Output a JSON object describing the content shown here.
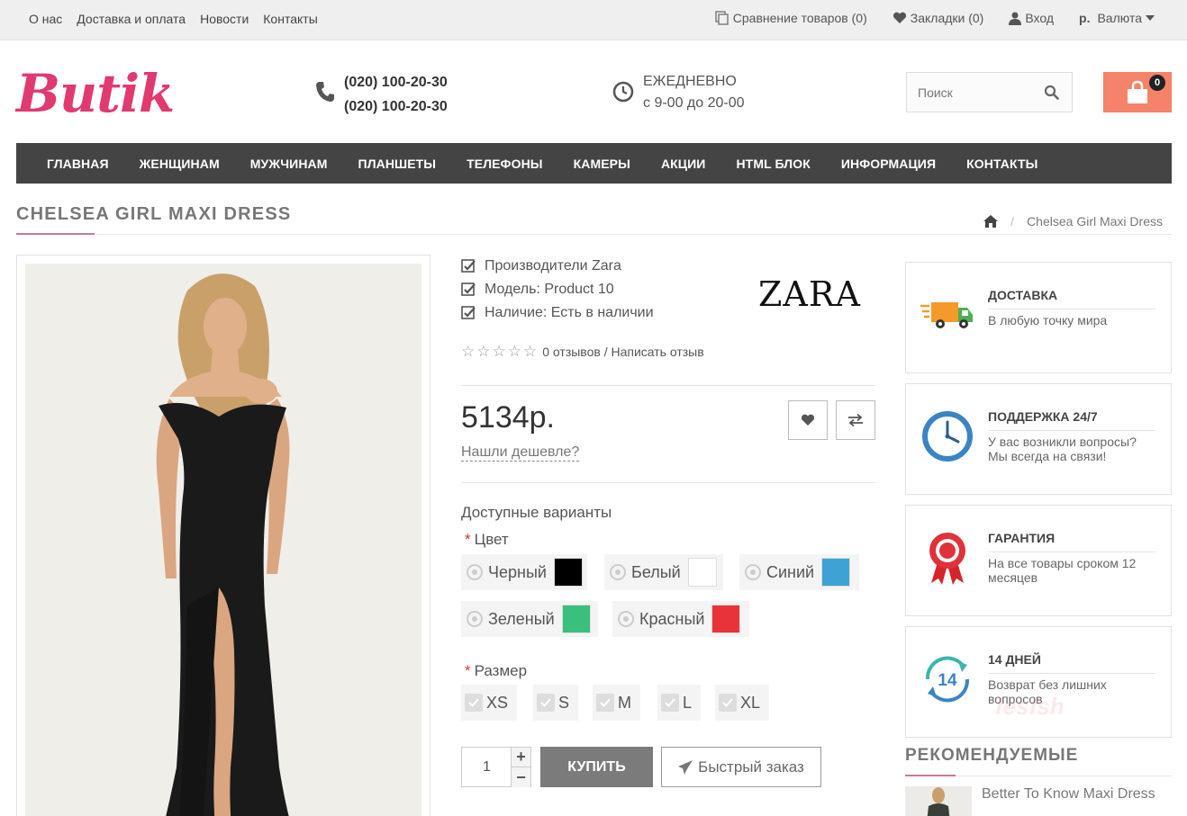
{
  "topbar": {
    "links": [
      "О нас",
      "Доставка и оплата",
      "Новости",
      "Контакты"
    ],
    "compare": "Сравнение товаров (0)",
    "bookmarks": "Закладки (0)",
    "login": "Вход",
    "currency_symbol": "р.",
    "currency_label": "Валюта"
  },
  "header": {
    "logo": "Butik",
    "phone1": "(020) 100-20-30",
    "phone2": "(020) 100-20-30",
    "hours_line1": "ЕЖЕДНЕВНО",
    "hours_line2": "с 9-00 до 20-00",
    "search_placeholder": "Поиск",
    "cart_count": "0"
  },
  "nav": [
    "ГЛАВНАЯ",
    "ЖЕНЩИНАМ",
    "МУЖЧИНАМ",
    "ПЛАНШЕТЫ",
    "ТЕЛЕФОНЫ",
    "КАМЕРЫ",
    "АКЦИИ",
    "HTML БЛОК",
    "ИНФОРМАЦИЯ",
    "КОНТАКТЫ"
  ],
  "page": {
    "title": "CHELSEA GIRL MAXI DRESS",
    "breadcrumb_current": "Chelsea Girl Maxi Dress"
  },
  "product": {
    "manufacturer": "Производители Zara",
    "model": "Модель: Product 10",
    "availability": "Наличие: Есть в наличии",
    "brand_logo": "ZARA",
    "rating_text": "0 отзывов / Написать отзыв",
    "rating_value": 0,
    "price": "5134р.",
    "cheaper_link": "Нашли дешевле?",
    "options_heading": "Доступные варианты",
    "color_label": "Цвет",
    "colors": [
      {
        "name": "Черный",
        "swatch": "#000000"
      },
      {
        "name": "Белый",
        "swatch": "#ffffff"
      },
      {
        "name": "Синий",
        "swatch": "#3fa2d4"
      },
      {
        "name": "Зеленый",
        "swatch": "#3bbf7c"
      },
      {
        "name": "Красный",
        "swatch": "#e8333a"
      }
    ],
    "size_label": "Размер",
    "sizes": [
      "XS",
      "S",
      "M",
      "L",
      "XL"
    ],
    "quantity": "1",
    "buy_label": "КУПИТЬ",
    "fast_order_label": "Быстрый заказ"
  },
  "features": [
    {
      "title": "ДОСТАВКА",
      "desc": "В любую точку мира",
      "icon": "delivery-truck-icon"
    },
    {
      "title": "ПОДДЕРЖКА 24/7",
      "desc": "У вас возникли вопросы? Мы всегда на связи!",
      "icon": "clock-icon"
    },
    {
      "title": "ГАРАНТИЯ",
      "desc": "На все товары сроком 12 месяцев",
      "icon": "award-ribbon-icon"
    },
    {
      "title": "14 ДНЕЙ",
      "desc": "Возврат без лишних вопросов",
      "icon": "return-14-days-icon",
      "icon_text": "14"
    }
  ],
  "recommended": {
    "title": "РЕКОМЕНДУЕМЫЕ",
    "items": [
      {
        "name": "Better To Know Maxi Dress"
      }
    ]
  },
  "watermark": "fesfsh"
}
